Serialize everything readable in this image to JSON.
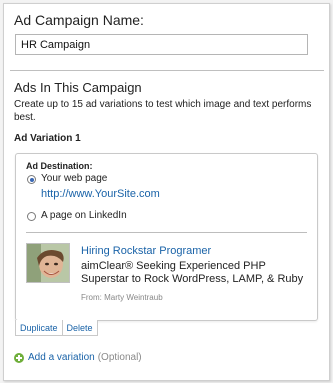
{
  "campaign": {
    "name_label": "Ad Campaign Name:",
    "name_value": "HR Campaign"
  },
  "ads_section": {
    "title": "Ads In This Campaign",
    "description": "Create up to 15 ad variations to test which image and text performs best."
  },
  "variation": {
    "title": "Ad Variation 1",
    "destination_label": "Ad Destination:",
    "options": [
      {
        "label": "Your web page",
        "url": "http://www.YourSite.com",
        "selected": true
      },
      {
        "label": "A page on LinkedIn",
        "selected": false
      }
    ],
    "preview": {
      "headline": "Hiring Rockstar Programer",
      "body": "aimClear® Seeking Experienced PHP Superstar to Rock WordPress, LAMP, & Ruby",
      "from": "From: Marty Weintraub"
    },
    "actions": {
      "duplicate": "Duplicate",
      "delete": "Delete"
    }
  },
  "add_variation": {
    "link": "Add a variation",
    "optional": "(Optional)"
  },
  "colors": {
    "link": "#1a63a8",
    "add_icon": "#6fae3a",
    "radio_checked": "#3a68b4"
  },
  "icons": [
    "radio-checked-icon",
    "radio-unchecked-icon",
    "plus-circle-icon",
    "profile-photo"
  ]
}
